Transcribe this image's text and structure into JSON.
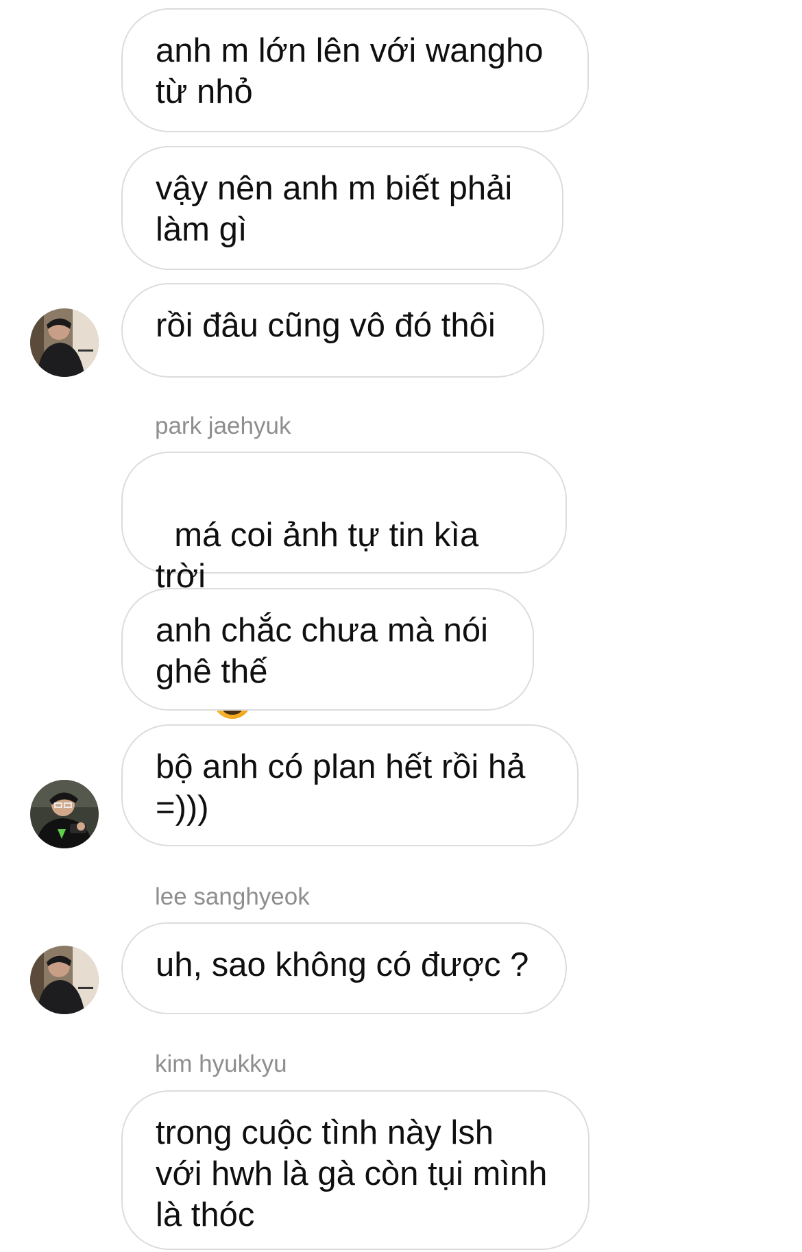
{
  "messages": [
    {
      "text": "anh m lớn lên với wangho\ntừ nhỏ"
    },
    {
      "text": "vậy nên anh m biết phải\nlàm gì"
    },
    {
      "text": "rồi đâu cũng vô đó thôi"
    },
    {
      "sender": "park jaehyuk",
      "text": "má coi ảnh tự tin kìa trời",
      "emoji": "grinning-face"
    },
    {
      "text": "anh chắc chưa mà nói\nghê thế"
    },
    {
      "text": "bộ anh có plan hết rồi hả\n=)))"
    },
    {
      "sender": "lee sanghyeok",
      "text": "uh, sao không có được ?"
    },
    {
      "sender": "kim hyukkyu",
      "text": "trong cuộc tình này lsh\nvới hwh là gà còn tụi mình\nlà thóc"
    }
  ],
  "colors": {
    "bubble_border": "#dcdcdc",
    "sender_text": "#8e8e8e",
    "message_text": "#0f0f0f"
  }
}
